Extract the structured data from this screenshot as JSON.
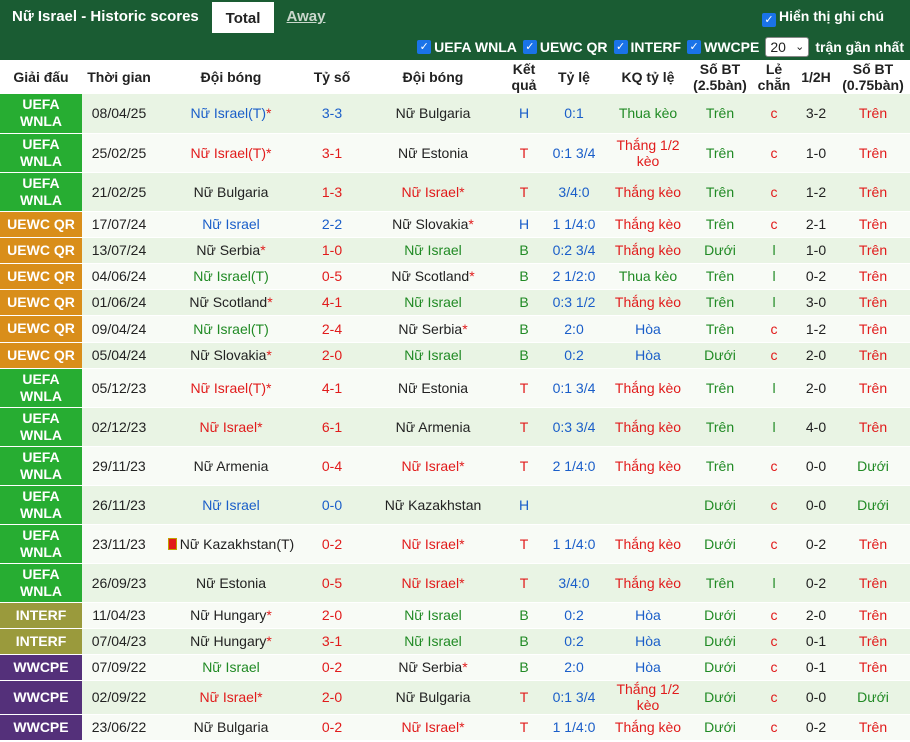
{
  "header": {
    "title": "Nữ Israel - Historic scores",
    "tab_total": "Total",
    "tab_away": "Away",
    "show_chinese": "Hiển thị ghi chú"
  },
  "filters": {
    "items": [
      "UEFA WNLA",
      "UEWC QR",
      "INTERF",
      "WWCPE"
    ],
    "count": "20",
    "suffix": "trận gần nhất"
  },
  "columns": [
    "Giải đấu",
    "Thời gian",
    "Đội bóng",
    "Tỷ số",
    "Đội bóng",
    "Kết quả",
    "Tỷ lệ",
    "KQ tỷ lệ",
    "Số BT (2.5bàn)",
    "Lẻ chẵn",
    "1/2H",
    "Số BT (0.75bàn)"
  ],
  "rows": [
    {
      "comp": "UEFA WNLA",
      "ctype": "wnla",
      "date": "08/04/25",
      "home": "Nữ Israel(T)",
      "home_ast": true,
      "hc": "blue",
      "score": "3-3",
      "sc": "blue",
      "away": "Nữ Bulgaria",
      "away_ast": false,
      "ac": "dark",
      "res": "H",
      "rc": "blue",
      "odds": "0:1",
      "kq": "Thua kèo",
      "kc": "green",
      "bt": "Trên",
      "btc": "green",
      "lc": "c",
      "lcc": "red",
      "half": "3-2",
      "bt2": "Trên",
      "bt2c": "red"
    },
    {
      "comp": "UEFA WNLA",
      "ctype": "wnla",
      "date": "25/02/25",
      "home": "Nữ Israel(T)",
      "home_ast": true,
      "hc": "red",
      "score": "3-1",
      "sc": "red",
      "away": "Nữ Estonia",
      "away_ast": false,
      "ac": "dark",
      "res": "T",
      "rc": "red",
      "odds": "0:1 3/4",
      "kq": "Thắng 1/2 kèo",
      "kc": "red",
      "bt": "Trên",
      "btc": "green",
      "lc": "c",
      "lcc": "red",
      "half": "1-0",
      "bt2": "Trên",
      "bt2c": "red"
    },
    {
      "comp": "UEFA WNLA",
      "ctype": "wnla",
      "date": "21/02/25",
      "home": "Nữ Bulgaria",
      "home_ast": false,
      "hc": "dark",
      "score": "1-3",
      "sc": "red",
      "away": "Nữ Israel",
      "away_ast": true,
      "ac": "red",
      "res": "T",
      "rc": "red",
      "odds": "3/4:0",
      "kq": "Thắng kèo",
      "kc": "red",
      "bt": "Trên",
      "btc": "green",
      "lc": "c",
      "lcc": "red",
      "half": "1-2",
      "bt2": "Trên",
      "bt2c": "red"
    },
    {
      "comp": "UEWC QR",
      "ctype": "uewc",
      "date": "17/07/24",
      "home": "Nữ Israel",
      "home_ast": false,
      "hc": "blue",
      "score": "2-2",
      "sc": "blue",
      "away": "Nữ Slovakia",
      "away_ast": true,
      "ac": "dark",
      "res": "H",
      "rc": "blue",
      "odds": "1 1/4:0",
      "kq": "Thắng kèo",
      "kc": "red",
      "bt": "Trên",
      "btc": "green",
      "lc": "c",
      "lcc": "red",
      "half": "2-1",
      "bt2": "Trên",
      "bt2c": "red"
    },
    {
      "comp": "UEWC QR",
      "ctype": "uewc",
      "date": "13/07/24",
      "home": "Nữ Serbia",
      "home_ast": true,
      "hc": "dark",
      "score": "1-0",
      "sc": "red",
      "away": "Nữ Israel",
      "away_ast": false,
      "ac": "green",
      "res": "B",
      "rc": "green",
      "odds": "0:2 3/4",
      "kq": "Thắng kèo",
      "kc": "red",
      "bt": "Dưới",
      "btc": "green",
      "lc": "l",
      "lcc": "green",
      "half": "1-0",
      "bt2": "Trên",
      "bt2c": "red"
    },
    {
      "comp": "UEWC QR",
      "ctype": "uewc",
      "date": "04/06/24",
      "home": "Nữ Israel(T)",
      "home_ast": false,
      "hc": "green",
      "score": "0-5",
      "sc": "red",
      "away": "Nữ Scotland",
      "away_ast": true,
      "ac": "dark",
      "res": "B",
      "rc": "green",
      "odds": "2 1/2:0",
      "kq": "Thua kèo",
      "kc": "green",
      "bt": "Trên",
      "btc": "green",
      "lc": "l",
      "lcc": "green",
      "half": "0-2",
      "bt2": "Trên",
      "bt2c": "red"
    },
    {
      "comp": "UEWC QR",
      "ctype": "uewc",
      "date": "01/06/24",
      "home": "Nữ Scotland",
      "home_ast": true,
      "hc": "dark",
      "score": "4-1",
      "sc": "red",
      "away": "Nữ Israel",
      "away_ast": false,
      "ac": "green",
      "res": "B",
      "rc": "green",
      "odds": "0:3 1/2",
      "kq": "Thắng kèo",
      "kc": "red",
      "bt": "Trên",
      "btc": "green",
      "lc": "l",
      "lcc": "green",
      "half": "3-0",
      "bt2": "Trên",
      "bt2c": "red"
    },
    {
      "comp": "UEWC QR",
      "ctype": "uewc",
      "date": "09/04/24",
      "home": "Nữ Israel(T)",
      "home_ast": false,
      "hc": "green",
      "score": "2-4",
      "sc": "red",
      "away": "Nữ Serbia",
      "away_ast": true,
      "ac": "dark",
      "res": "B",
      "rc": "green",
      "odds": "2:0",
      "kq": "Hòa",
      "kc": "blue",
      "bt": "Trên",
      "btc": "green",
      "lc": "c",
      "lcc": "red",
      "half": "1-2",
      "bt2": "Trên",
      "bt2c": "red"
    },
    {
      "comp": "UEWC QR",
      "ctype": "uewc",
      "date": "05/04/24",
      "home": "Nữ Slovakia",
      "home_ast": true,
      "hc": "dark",
      "score": "2-0",
      "sc": "red",
      "away": "Nữ Israel",
      "away_ast": false,
      "ac": "green",
      "res": "B",
      "rc": "green",
      "odds": "0:2",
      "kq": "Hòa",
      "kc": "blue",
      "bt": "Dưới",
      "btc": "green",
      "lc": "c",
      "lcc": "red",
      "half": "2-0",
      "bt2": "Trên",
      "bt2c": "red"
    },
    {
      "comp": "UEFA WNLA",
      "ctype": "wnla",
      "date": "05/12/23",
      "home": "Nữ Israel(T)",
      "home_ast": true,
      "hc": "red",
      "score": "4-1",
      "sc": "red",
      "away": "Nữ Estonia",
      "away_ast": false,
      "ac": "dark",
      "res": "T",
      "rc": "red",
      "odds": "0:1 3/4",
      "kq": "Thắng kèo",
      "kc": "red",
      "bt": "Trên",
      "btc": "green",
      "lc": "l",
      "lcc": "green",
      "half": "2-0",
      "bt2": "Trên",
      "bt2c": "red"
    },
    {
      "comp": "UEFA WNLA",
      "ctype": "wnla",
      "date": "02/12/23",
      "home": "Nữ Israel",
      "home_ast": true,
      "hc": "red",
      "score": "6-1",
      "sc": "red",
      "away": "Nữ Armenia",
      "away_ast": false,
      "ac": "dark",
      "res": "T",
      "rc": "red",
      "odds": "0:3 3/4",
      "kq": "Thắng kèo",
      "kc": "red",
      "bt": "Trên",
      "btc": "green",
      "lc": "l",
      "lcc": "green",
      "half": "4-0",
      "bt2": "Trên",
      "bt2c": "red"
    },
    {
      "comp": "UEFA WNLA",
      "ctype": "wnla",
      "date": "29/11/23",
      "home": "Nữ Armenia",
      "home_ast": false,
      "hc": "dark",
      "score": "0-4",
      "sc": "red",
      "away": "Nữ Israel",
      "away_ast": true,
      "ac": "red",
      "res": "T",
      "rc": "red",
      "odds": "2 1/4:0",
      "kq": "Thắng kèo",
      "kc": "red",
      "bt": "Trên",
      "btc": "green",
      "lc": "c",
      "lcc": "red",
      "half": "0-0",
      "bt2": "Dưới",
      "bt2c": "green"
    },
    {
      "comp": "UEFA WNLA",
      "ctype": "wnla",
      "date": "26/11/23",
      "home": "Nữ Israel",
      "home_ast": false,
      "hc": "blue",
      "score": "0-0",
      "sc": "blue",
      "away": "Nữ Kazakhstan",
      "away_ast": false,
      "ac": "dark",
      "res": "H",
      "rc": "blue",
      "odds": "",
      "kq": "",
      "kc": "dark",
      "bt": "Dưới",
      "btc": "green",
      "lc": "c",
      "lcc": "red",
      "half": "0-0",
      "bt2": "Dưới",
      "bt2c": "green"
    },
    {
      "comp": "UEFA WNLA",
      "ctype": "wnla",
      "date": "23/11/23",
      "home": "Nữ Kazakhstan(T)",
      "home_ast": false,
      "hc": "dark",
      "flag": true,
      "score": "0-2",
      "sc": "red",
      "away": "Nữ Israel",
      "away_ast": true,
      "ac": "red",
      "res": "T",
      "rc": "red",
      "odds": "1 1/4:0",
      "kq": "Thắng kèo",
      "kc": "red",
      "bt": "Dưới",
      "btc": "green",
      "lc": "c",
      "lcc": "red",
      "half": "0-2",
      "bt2": "Trên",
      "bt2c": "red"
    },
    {
      "comp": "UEFA WNLA",
      "ctype": "wnla",
      "date": "26/09/23",
      "home": "Nữ Estonia",
      "home_ast": false,
      "hc": "dark",
      "score": "0-5",
      "sc": "red",
      "away": "Nữ Israel",
      "away_ast": true,
      "ac": "red",
      "res": "T",
      "rc": "red",
      "odds": "3/4:0",
      "kq": "Thắng kèo",
      "kc": "red",
      "bt": "Trên",
      "btc": "green",
      "lc": "l",
      "lcc": "green",
      "half": "0-2",
      "bt2": "Trên",
      "bt2c": "red"
    },
    {
      "comp": "INTERF",
      "ctype": "interf",
      "date": "11/04/23",
      "home": "Nữ Hungary",
      "home_ast": true,
      "hc": "dark",
      "score": "2-0",
      "sc": "red",
      "away": "Nữ Israel",
      "away_ast": false,
      "ac": "green",
      "res": "B",
      "rc": "green",
      "odds": "0:2",
      "kq": "Hòa",
      "kc": "blue",
      "bt": "Dưới",
      "btc": "green",
      "lc": "c",
      "lcc": "red",
      "half": "2-0",
      "bt2": "Trên",
      "bt2c": "red"
    },
    {
      "comp": "INTERF",
      "ctype": "interf",
      "date": "07/04/23",
      "home": "Nữ Hungary",
      "home_ast": true,
      "hc": "dark",
      "score": "3-1",
      "sc": "red",
      "away": "Nữ Israel",
      "away_ast": false,
      "ac": "green",
      "res": "B",
      "rc": "green",
      "odds": "0:2",
      "kq": "Hòa",
      "kc": "blue",
      "bt": "Dưới",
      "btc": "green",
      "lc": "c",
      "lcc": "red",
      "half": "0-1",
      "bt2": "Trên",
      "bt2c": "red"
    },
    {
      "comp": "WWCPE",
      "ctype": "wwcpe",
      "date": "07/09/22",
      "home": "Nữ Israel",
      "home_ast": false,
      "hc": "green",
      "score": "0-2",
      "sc": "red",
      "away": "Nữ Serbia",
      "away_ast": true,
      "ac": "dark",
      "res": "B",
      "rc": "green",
      "odds": "2:0",
      "kq": "Hòa",
      "kc": "blue",
      "bt": "Dưới",
      "btc": "green",
      "lc": "c",
      "lcc": "red",
      "half": "0-1",
      "bt2": "Trên",
      "bt2c": "red"
    },
    {
      "comp": "WWCPE",
      "ctype": "wwcpe",
      "date": "02/09/22",
      "home": "Nữ Israel",
      "home_ast": true,
      "hc": "red",
      "score": "2-0",
      "sc": "red",
      "away": "Nữ Bulgaria",
      "away_ast": false,
      "ac": "dark",
      "res": "T",
      "rc": "red",
      "odds": "0:1 3/4",
      "kq": "Thắng 1/2 kèo",
      "kc": "red",
      "bt": "Dưới",
      "btc": "green",
      "lc": "c",
      "lcc": "red",
      "half": "0-0",
      "bt2": "Dưới",
      "bt2c": "green"
    },
    {
      "comp": "WWCPE",
      "ctype": "wwcpe",
      "date": "23/06/22",
      "home": "Nữ Bulgaria",
      "home_ast": false,
      "hc": "dark",
      "score": "0-2",
      "sc": "red",
      "away": "Nữ Israel",
      "away_ast": true,
      "ac": "red",
      "res": "T",
      "rc": "red",
      "odds": "1 1/4:0",
      "kq": "Thắng kèo",
      "kc": "red",
      "bt": "Dưới",
      "btc": "green",
      "lc": "c",
      "lcc": "red",
      "half": "0-2",
      "bt2": "Trên",
      "bt2c": "red"
    }
  ]
}
